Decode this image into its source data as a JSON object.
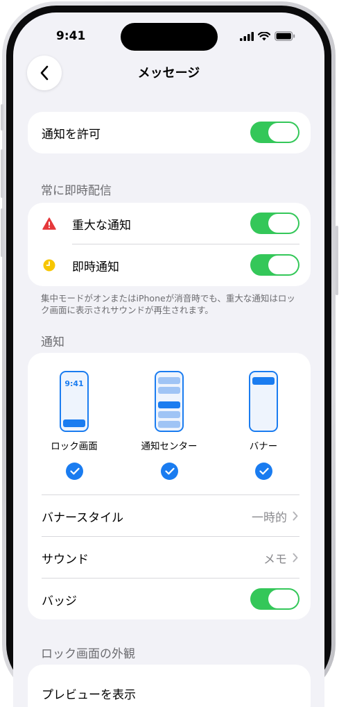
{
  "status_bar": {
    "time": "9:41"
  },
  "nav": {
    "title": "メッセージ"
  },
  "allow": {
    "label": "通知を許可",
    "on": true
  },
  "immediate": {
    "header": "常に即時配信",
    "critical_label": "重大な通知",
    "time_sensitive_label": "即時通知",
    "footnote": "集中モードがオンまたはiPhoneが消音時でも、重大な通知はロック画面に表示されサウンドが再生されます。"
  },
  "notifications": {
    "header": "通知",
    "styles": [
      {
        "label": "ロック画面",
        "preview_time": "9:41",
        "checked": true
      },
      {
        "label": "通知センター",
        "checked": true
      },
      {
        "label": "バナー",
        "checked": true
      }
    ],
    "banner_style": {
      "label": "バナースタイル",
      "value": "一時的"
    },
    "sound": {
      "label": "サウンド",
      "value": "メモ"
    },
    "badges": {
      "label": "バッジ",
      "on": true
    }
  },
  "lock_screen": {
    "header": "ロック画面の外観",
    "show_previews_label": "プレビューを表示"
  },
  "colors": {
    "accent": "#1a7cf0",
    "toggle_on": "#34c759",
    "critical": "#e5383b",
    "time_sensitive": "#f7c600"
  }
}
